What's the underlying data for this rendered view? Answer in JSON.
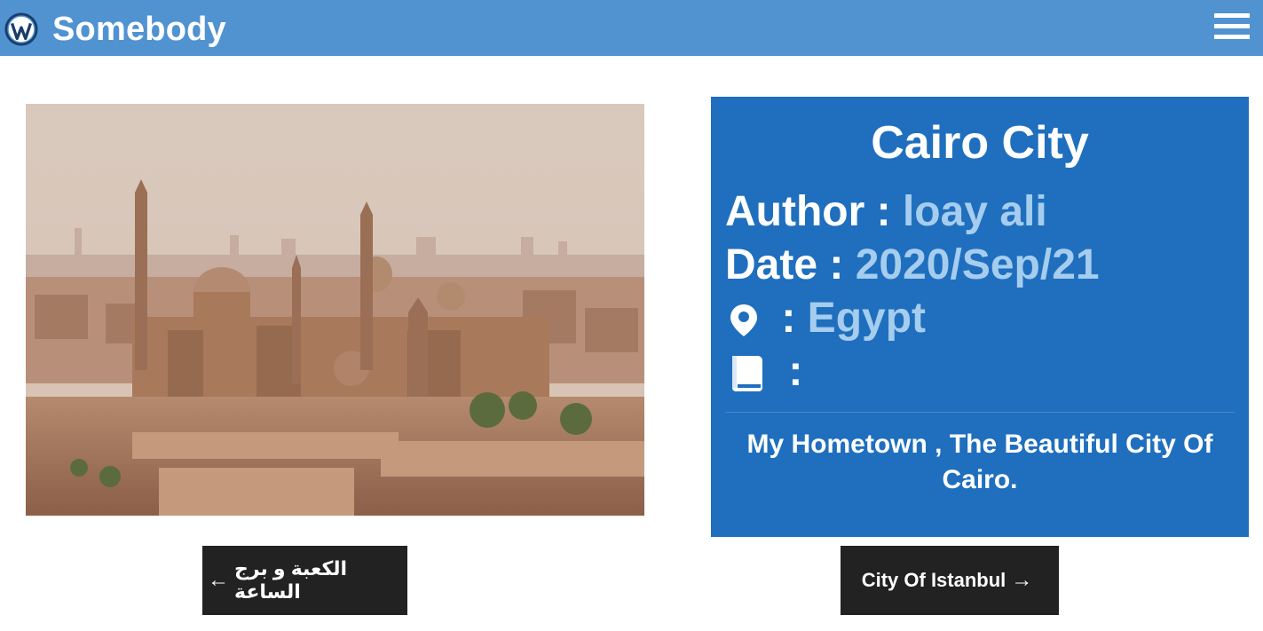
{
  "header": {
    "site_title": "Somebody",
    "logo_icon": "wordpress-logo-icon",
    "menu_icon": "hamburger-menu-icon",
    "background_color": "#5093d0"
  },
  "post": {
    "image_description": "Cairo skyline with mosques",
    "title": "Cairo City",
    "author_label": "Author :",
    "author_value": "loay ali",
    "date_label": "Date :",
    "date_value": "2020/Sep/21",
    "location_icon": "map-pin-icon",
    "location_separator": ":",
    "location_value": "Egypt",
    "category_icon": "book-icon",
    "category_separator": ":",
    "category_value": "",
    "description": "My Hometown , The Beautiful City Of Cairo.",
    "card_color": "#1f6fbe",
    "value_color": "#a6cdee"
  },
  "navigation": {
    "prev_label": "الكعبة و برج الساعة",
    "prev_arrow": "←",
    "next_label": "City Of Istanbul",
    "next_arrow": "→"
  }
}
